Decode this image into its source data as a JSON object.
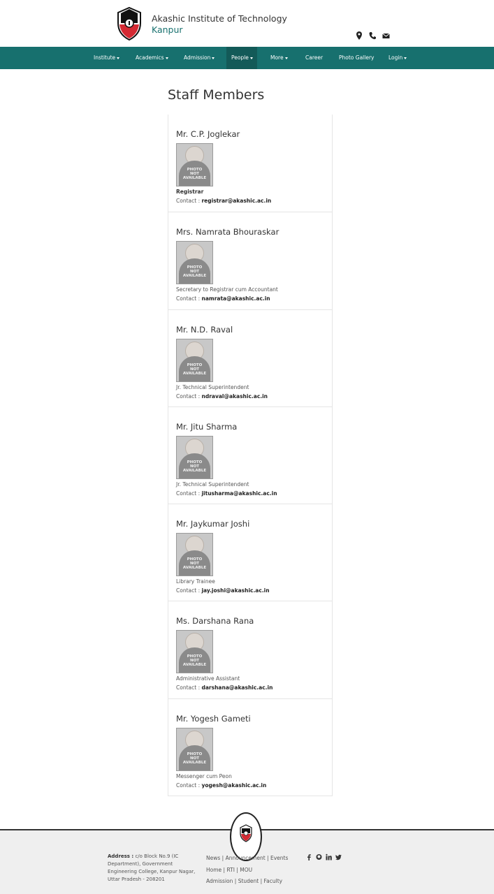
{
  "header": {
    "institute_name": "Akashic Institute of Technology",
    "city": "Kanpur",
    "icons": [
      "map-marker-icon",
      "phone-icon",
      "envelope-icon"
    ]
  },
  "nav": {
    "items": [
      {
        "label": "Institute",
        "dropdown": true
      },
      {
        "label": "Academics",
        "dropdown": true
      },
      {
        "label": "Admission",
        "dropdown": true
      },
      {
        "label": "People",
        "dropdown": true,
        "active": true
      },
      {
        "label": "More",
        "dropdown": true
      },
      {
        "label": "Career",
        "dropdown": false
      },
      {
        "label": "Photo Gallery",
        "dropdown": false
      },
      {
        "label": "Login",
        "dropdown": true
      }
    ]
  },
  "main": {
    "title": "Staff Members",
    "photo_placeholder": [
      "PHOTO",
      "NOT",
      "AVAILABLE"
    ],
    "contact_label": "Contact :",
    "staff": [
      {
        "name": "Mr. C.P. Joglekar",
        "role": "Registrar",
        "email": "registrar@akashic.ac.in"
      },
      {
        "name": "Mrs. Namrata Bhouraskar",
        "role": "Secretary to Registrar cum Accountant",
        "email": "namrata@akashic.ac.in"
      },
      {
        "name": "Mr. N.D. Raval",
        "role": "Jr. Technical Superintendent",
        "email": "ndraval@akashic.ac.in"
      },
      {
        "name": "Mr. Jitu Sharma",
        "role": "Jr. Technical Superintendent",
        "email": "jitusharma@akashic.ac.in"
      },
      {
        "name": "Mr. Jaykumar Joshi",
        "role": "Library Trainee",
        "email": "jay.joshi@akashic.ac.in"
      },
      {
        "name": "Ms. Darshana Rana",
        "role": "Administrative Assistant",
        "email": "darshana@akashic.ac.in"
      },
      {
        "name": "Mr. Yogesh Gameti",
        "role": "Messenger cum Peon",
        "email": "yogesh@akashic.ac.in"
      }
    ]
  },
  "footer": {
    "address_label": "Address :",
    "address": "c/o Block No.9 (IC Department), Government Engineering College, Kanpur Nagar, Uttar Pradesh - 208201",
    "links_row1": [
      "News",
      "Announcement",
      "Events"
    ],
    "links_row2": [
      "Home",
      "RTI",
      "MOU"
    ],
    "links_row3": [
      "Admission",
      "Student",
      "Faculty"
    ],
    "social_icons": [
      "facebook-icon",
      "github-icon",
      "linkedin-icon",
      "twitter-icon"
    ]
  },
  "colors": {
    "brand_teal": "#17706e",
    "nav_active": "#135a58",
    "logo_red": "#d42a33"
  }
}
